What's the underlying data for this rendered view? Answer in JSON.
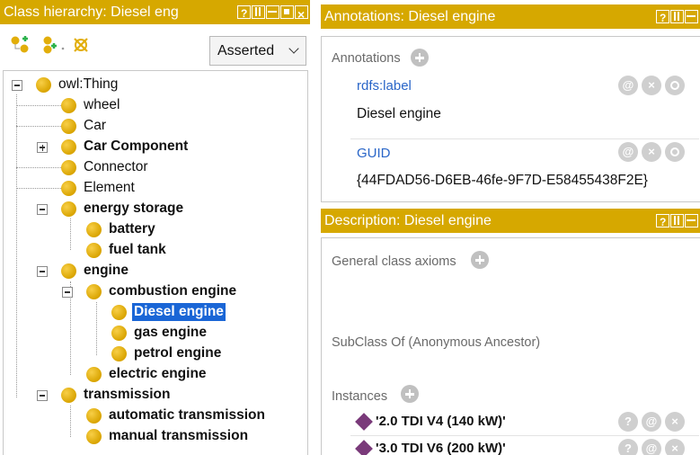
{
  "class_hierarchy": {
    "header_title": "Class hierarchy: Diesel eng",
    "header_buttons": [
      "help-icon",
      "split-columns-icon",
      "split-rows-icon",
      "maximize-icon",
      "close-icon"
    ],
    "toolbar_icons": [
      "add-subclass-icon",
      "add-sibling-icon",
      "delete-class-icon"
    ],
    "view_mode": "Asserted",
    "tree": [
      {
        "label": "owl:Thing",
        "bold": false
      },
      {
        "label": "wheel",
        "bold": false
      },
      {
        "label": "Car",
        "bold": false
      },
      {
        "label": "Car Component",
        "bold": true
      },
      {
        "label": "Connector",
        "bold": false
      },
      {
        "label": "Element",
        "bold": false
      },
      {
        "label": "energy storage",
        "bold": true
      },
      {
        "label": "battery",
        "bold": true
      },
      {
        "label": "fuel tank",
        "bold": true
      },
      {
        "label": "engine",
        "bold": true
      },
      {
        "label": "combustion engine",
        "bold": true
      },
      {
        "label": "Diesel engine",
        "bold": true,
        "selected": true
      },
      {
        "label": "gas engine",
        "bold": true
      },
      {
        "label": "petrol engine",
        "bold": true
      },
      {
        "label": "electric engine",
        "bold": true
      },
      {
        "label": "transmission",
        "bold": true
      },
      {
        "label": "automatic transmission",
        "bold": true
      },
      {
        "label": "manual transmission",
        "bold": true
      }
    ]
  },
  "annotations": {
    "header_title": "Annotations: Diesel engine",
    "section_label": "Annotations",
    "items": [
      {
        "property": "rdfs:label",
        "value": "Diesel engine"
      },
      {
        "property": "GUID",
        "value": "{44FDAD56-D6EB-46fe-9F7D-E58455438F2E}"
      }
    ],
    "row_buttons": [
      "@",
      "×",
      "o"
    ]
  },
  "description": {
    "header_title": "Description: Diesel engine",
    "general_axioms_label": "General class axioms",
    "subclass_label": "SubClass Of (Anonymous Ancestor)",
    "instances_label": "Instances",
    "instances": [
      "'2.0 TDI V4 (140 kW)'",
      "'3.0 TDI V6 (200 kW)'"
    ],
    "row_buttons": [
      "?",
      "@",
      "×"
    ]
  },
  "colors": {
    "header_bg": "#d6a800",
    "class_dot": "#e2ae0a",
    "selection": "#1a66d6",
    "link": "#2a66c8",
    "individual": "#7a3a7a"
  }
}
